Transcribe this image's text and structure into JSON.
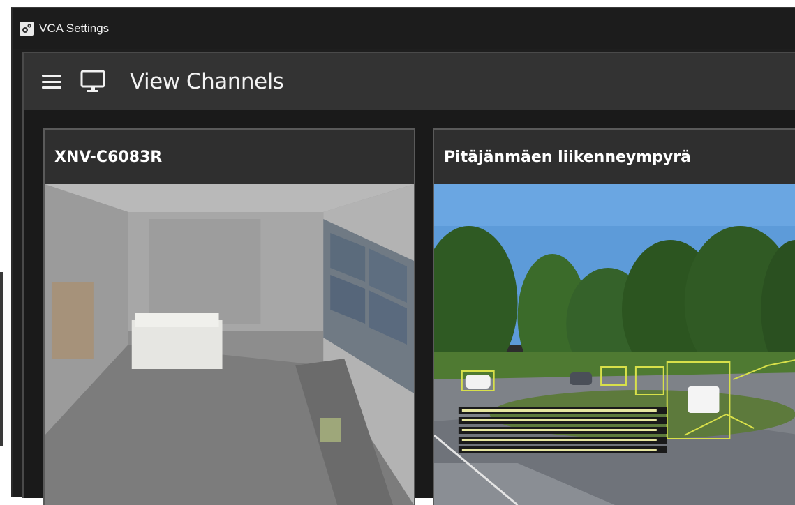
{
  "window": {
    "title": "VCA Settings",
    "icon": "gear-icon"
  },
  "header": {
    "menu_icon": "hamburger-icon",
    "section_icon": "monitor-icon",
    "title": "View Channels"
  },
  "channels": [
    {
      "name": "XNV-C6083R",
      "thumbnail": "indoor-room-feed"
    },
    {
      "name": "Pitäjänmäen liikenneympyrä",
      "thumbnail": "roundabout-traffic-feed"
    }
  ],
  "colors": {
    "window_bg": "#1e1e1e",
    "header_bg": "#333333",
    "card_bg": "#2d2d2d",
    "card_border": "#5a5a5a",
    "detection_box": "#d8e04a"
  }
}
